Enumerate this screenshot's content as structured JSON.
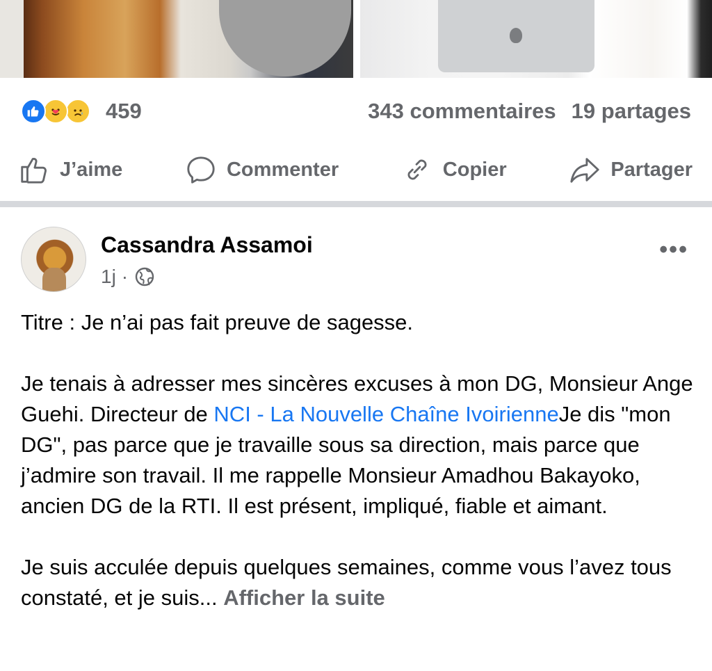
{
  "stats": {
    "reaction_count": "459",
    "comments": "343 commentaires",
    "shares": "19 partages",
    "reactions": [
      "like-icon",
      "care-icon",
      "sad-icon"
    ]
  },
  "actions": {
    "like": "J’aime",
    "comment": "Commenter",
    "copy": "Copier",
    "share": "Partager"
  },
  "post": {
    "author": "Cassandra Assamoi",
    "time": "1j",
    "separator": "·",
    "more": "•••",
    "title_line": "Titre : Je n’ai pas fait preuve de sagesse.",
    "para1_a": "Je tenais à adresser mes sincères excuses à mon DG, Monsieur Ange Guehi. Directeur de ",
    "para1_link": "NCI - La Nouvelle Chaîne Ivoirienne",
    "para1_b": "Je dis \"mon DG\", pas parce que je travaille sous sa direction, mais parce que j’admire son travail. Il me rappelle Monsieur Amadhou Bakayoko, ancien DG de la RTI. Il est présent, impliqué, fiable et aimant.",
    "para2": "Je suis acculée depuis quelques semaines, comme vous l’avez tous constaté, et  je suis... ",
    "see_more": "Afficher la suite"
  },
  "colors": {
    "accent": "#1877f2",
    "secondary_text": "#65676b",
    "divider": "#d6d8dc"
  }
}
